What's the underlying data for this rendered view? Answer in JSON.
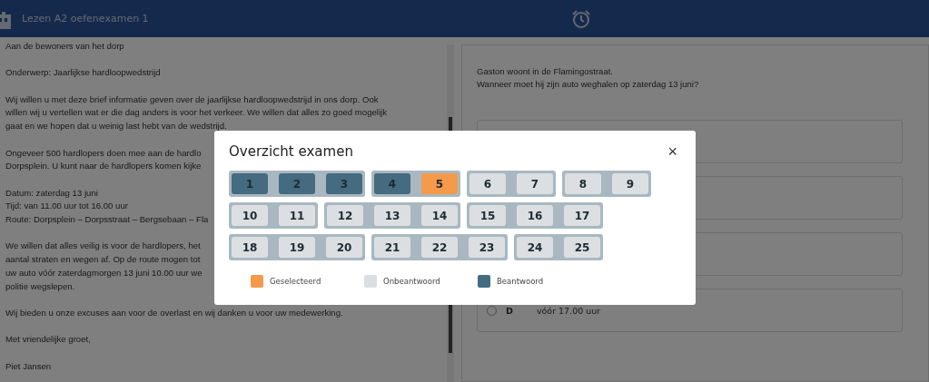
{
  "header": {
    "title": "Lezen A2 oefenexamen 1"
  },
  "text": {
    "paragraphs": [
      [
        "Aan de bewoners van het dorp"
      ],
      [
        "Onderwerp: Jaarlijkse hardloopwedstrijd"
      ],
      [
        "Wij willen u met deze brief informatie geven over de jaarlijkse hardloopwedstrijd in ons dorp. Ook",
        "willen wij u vertellen wat er die dag anders is voor het verkeer. We willen dat alles zo goed mogelijk",
        "gaat en we hopen dat u weinig last hebt van de wedstrijd."
      ],
      [
        "Ongeveer 500 hardlopers doen mee aan de hardlo",
        "Dorpsplein. U kunt naar de hardlopers komen kijke"
      ],
      [
        "Datum: zaterdag 13 juni",
        "Tijd: van 11.00 uur tot 16.00 uur",
        "Route: Dorpsplein – Dorpsstraat – Bergsebaan – Fla"
      ],
      [
        "We willen dat alles veilig is voor de hardlopers, het",
        "aantal straten en wegen af. Op de route mogen tot",
        "uw auto vóór zaterdagmorgen 13 juni 10.00 uur we",
        "politie wegslepen."
      ],
      [
        "Wij bieden u onze excuses aan voor de overlast en wij danken u voor uw medewerking."
      ],
      [
        "Met vriendelijke groet,"
      ],
      [
        "Piet Jansen"
      ]
    ]
  },
  "question": {
    "lines": [
      "Gaston woont in de Flamingostraat.",
      "Wanneer moet hij zijn auto weghalen op zaterdag 13 juni?"
    ],
    "options": [
      {
        "kind": "covered"
      },
      {
        "kind": "covered"
      },
      {
        "kind": "covered"
      },
      {
        "kind": "option",
        "letter": "D",
        "text": "vóór 17.00 uur",
        "checked": false
      }
    ]
  },
  "modal": {
    "title": "Overzicht examen",
    "close": "×",
    "rows": [
      {
        "groups": [
          {
            "questions": [
              {
                "number": "1",
                "answered": true,
                "selected": false
              },
              {
                "number": "2",
                "answered": true,
                "selected": false
              },
              {
                "number": "3",
                "answered": true,
                "selected": false
              }
            ]
          },
          {
            "questions": [
              {
                "number": "4",
                "answered": true,
                "selected": false
              },
              {
                "number": "5",
                "answered": false,
                "selected": true
              }
            ]
          },
          {
            "questions": [
              {
                "number": "6",
                "answered": false,
                "selected": false
              },
              {
                "number": "7",
                "answered": false,
                "selected": false
              }
            ]
          },
          {
            "questions": [
              {
                "number": "8",
                "answered": false,
                "selected": false
              },
              {
                "number": "9",
                "answered": false,
                "selected": false
              }
            ]
          }
        ]
      },
      {
        "groups": [
          {
            "questions": [
              {
                "number": "10",
                "answered": false,
                "selected": false
              },
              {
                "number": "11",
                "answered": false,
                "selected": false
              }
            ]
          },
          {
            "questions": [
              {
                "number": "12",
                "answered": false,
                "selected": false
              },
              {
                "number": "13",
                "answered": false,
                "selected": false
              },
              {
                "number": "14",
                "answered": false,
                "selected": false
              }
            ]
          },
          {
            "questions": [
              {
                "number": "15",
                "answered": false,
                "selected": false
              },
              {
                "number": "16",
                "answered": false,
                "selected": false
              },
              {
                "number": "17",
                "answered": false,
                "selected": false
              }
            ]
          }
        ]
      },
      {
        "groups": [
          {
            "questions": [
              {
                "number": "18",
                "answered": false,
                "selected": false
              },
              {
                "number": "19",
                "answered": false,
                "selected": false
              },
              {
                "number": "20",
                "answered": false,
                "selected": false
              }
            ]
          },
          {
            "questions": [
              {
                "number": "21",
                "answered": false,
                "selected": false
              },
              {
                "number": "22",
                "answered": false,
                "selected": false
              },
              {
                "number": "23",
                "answered": false,
                "selected": false
              }
            ]
          },
          {
            "questions": [
              {
                "number": "24",
                "answered": false,
                "selected": false
              },
              {
                "number": "25",
                "answered": false,
                "selected": false
              }
            ]
          }
        ]
      }
    ],
    "legend": [
      {
        "label": "Geselecteerd",
        "color": "#f5994a"
      },
      {
        "label": "Onbeantwoord",
        "color": "#dcdfe2"
      },
      {
        "label": "Beantwoord",
        "color": "#446b80"
      }
    ]
  }
}
